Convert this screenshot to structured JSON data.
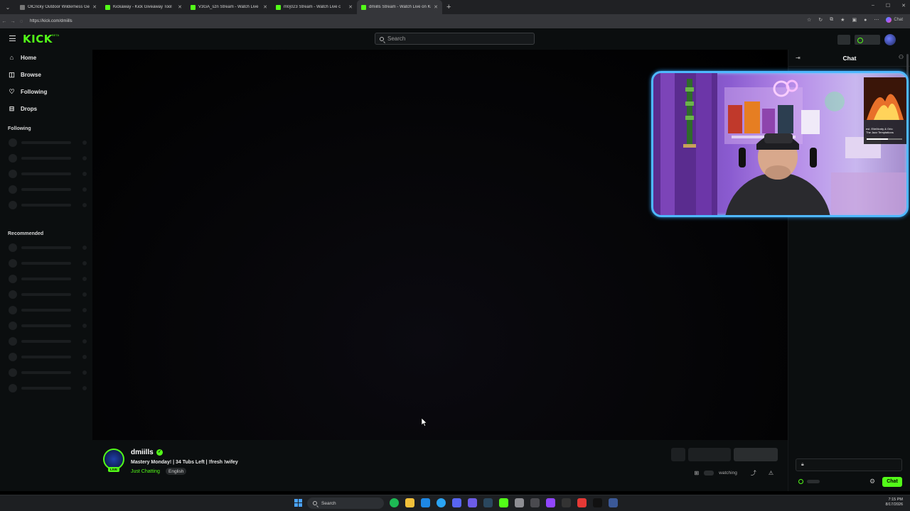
{
  "browser": {
    "tabs": [
      {
        "title": "OlCricky Outdoor Wilderness Gen",
        "active": false
      },
      {
        "title": "Kickaway - Kick Giveaway Tool",
        "active": false
      },
      {
        "title": "V3GA_szn Stream - Watch Live",
        "active": false
      },
      {
        "title": "m0j023 Stream - Watch Live c",
        "active": false
      },
      {
        "title": "dmiills Stream - Watch Live on Kick",
        "active": true
      }
    ],
    "url": "https://kick.com/dmiills",
    "copilot_label": "Chat"
  },
  "header": {
    "logo": "KICK",
    "logo_badge": "BETA",
    "search_placeholder": "Search"
  },
  "sidebar": {
    "nav": [
      {
        "label": "Home",
        "icon": "home-icon"
      },
      {
        "label": "Browse",
        "icon": "browse-icon"
      },
      {
        "label": "Following",
        "icon": "heart-icon"
      },
      {
        "label": "Drops",
        "icon": "drops-icon"
      }
    ],
    "following_title": "Following",
    "recommended_title": "Recommended"
  },
  "channel": {
    "name": "dmiills",
    "live_badge": "LIVE",
    "title": "Mastery Monday! | 34 Tubs Left | !fresh !wifey",
    "category": "Just Chatting",
    "language": "English",
    "watching_label": "watching"
  },
  "webcam": {
    "overlay_line1": "est. EileMonty & Orlo",
    "overlay_line2": "The Jazz Temptations"
  },
  "chat": {
    "title": "Chat",
    "send_label": "Chat"
  },
  "taskbar": {
    "search_label": "Search",
    "time": "7:15 PM",
    "date": "8/17/2026"
  },
  "colors": {
    "brand_green": "#53fc18",
    "webcam_border": "#4fb8ff",
    "background": "#0b0e0f"
  }
}
